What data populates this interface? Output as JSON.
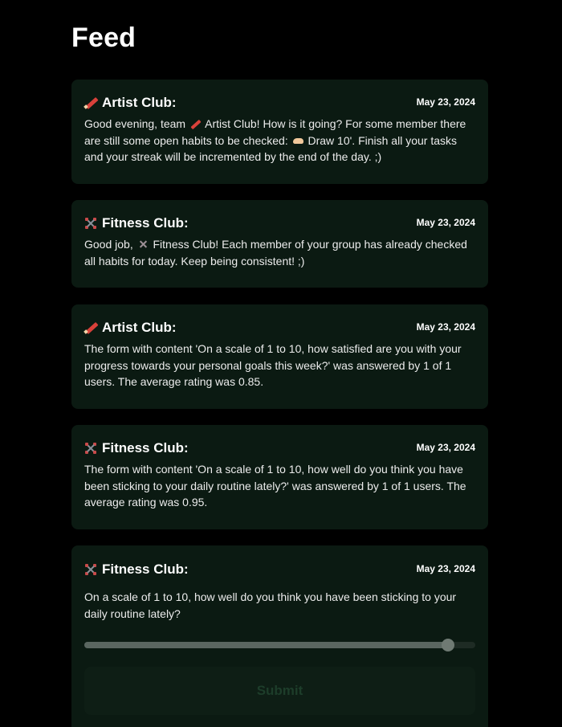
{
  "page": {
    "title": "Feed"
  },
  "feed": {
    "items": [
      {
        "club": "Artist Club:",
        "icon": "pencil-icon",
        "date": "May 23, 2024",
        "text_parts": [
          "Good evening, team ",
          " Artist Club! How is it going? For some member there are still some open habits to be checked: ",
          " Draw 10'. Finish all your tasks and your streak will be incremented by the end of the day. ;)"
        ]
      },
      {
        "club": "Fitness Club:",
        "icon": "dumbbell-icon",
        "date": "May 23, 2024",
        "text_parts": [
          "Good job, ",
          " Fitness Club! Each member of your group has already checked all habits for today. Keep being consistent! ;)"
        ]
      },
      {
        "club": "Artist Club:",
        "icon": "pencil-icon",
        "date": "May 23, 2024",
        "text": "The form with content 'On a scale of 1 to 10, how satisfied are you with your progress towards your personal goals this week?' was answered by 1 of 1 users. The average rating was 0.85."
      },
      {
        "club": "Fitness Club:",
        "icon": "dumbbell-icon",
        "date": "May 23, 2024",
        "text": "The form with content 'On a scale of 1 to 10, how well do you think you have been sticking to your daily routine lately?' was answered by 1 of 1 users. The average rating was 0.95."
      },
      {
        "club": "Fitness Club:",
        "icon": "dumbbell-icon",
        "date": "May 23, 2024",
        "question": "On a scale of 1 to 10, how well do you think you have been sticking to your daily routine lately?",
        "slider_value_fraction": 0.93,
        "submit_label": "Submit"
      }
    ]
  },
  "colors": {
    "background": "#000000",
    "card": "#0b1a12",
    "pencil": "#d8413a",
    "submit_text_disabled": "#1d3d2a"
  }
}
